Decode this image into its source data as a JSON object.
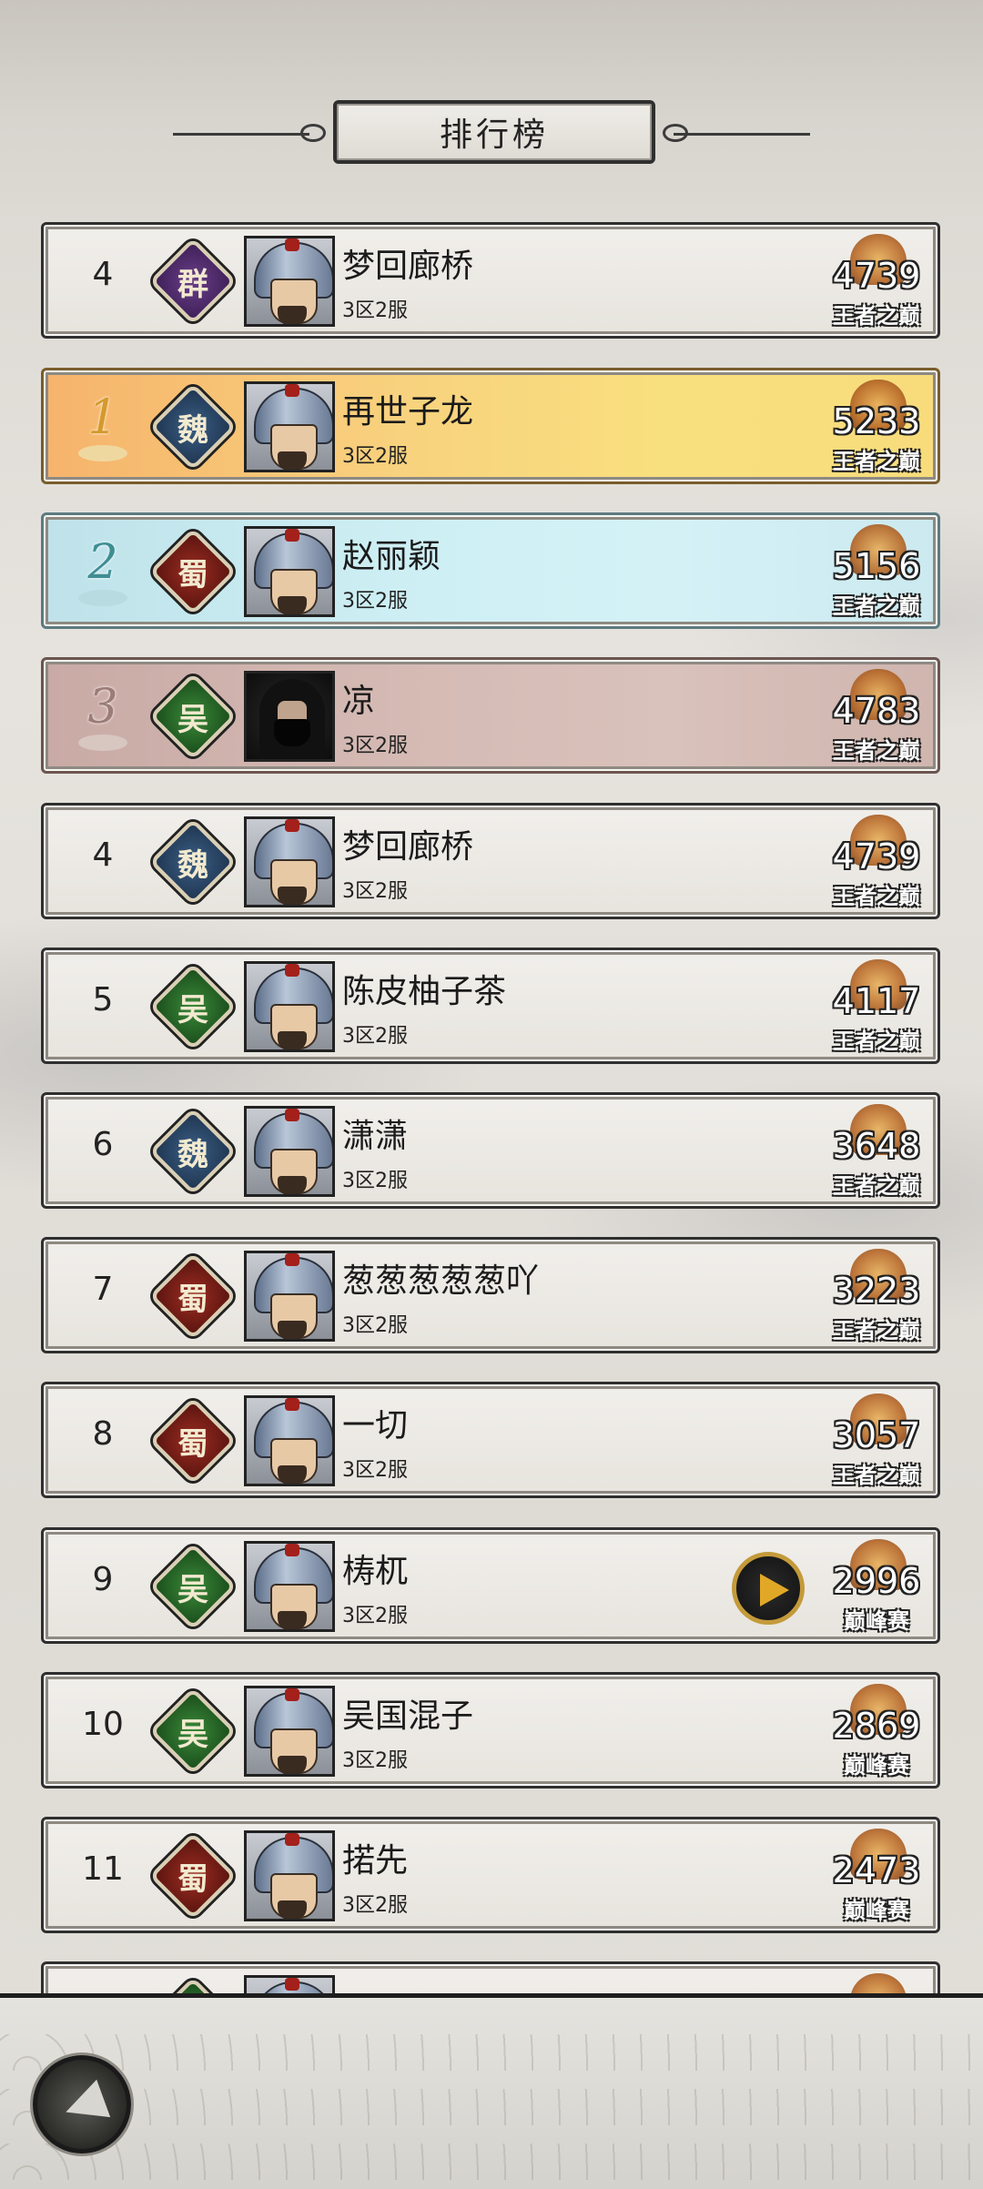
{
  "header": {
    "title": "排行榜"
  },
  "my_entry": {
    "rank": "4",
    "faction": "群",
    "name": "梦回廊桥",
    "server": "3区2服",
    "score": "4739",
    "tier": "王者之巅"
  },
  "entries": [
    {
      "rank": "1",
      "faction": "魏",
      "name": "再世子龙",
      "server": "3区2服",
      "score": "5233",
      "tier": "王者之巅"
    },
    {
      "rank": "2",
      "faction": "蜀",
      "name": "赵丽颖",
      "server": "3区2服",
      "score": "5156",
      "tier": "王者之巅"
    },
    {
      "rank": "3",
      "faction": "吴",
      "name": "凉",
      "server": "3区2服",
      "score": "4783",
      "tier": "王者之巅"
    },
    {
      "rank": "4",
      "faction": "魏",
      "name": "梦回廊桥",
      "server": "3区2服",
      "score": "4739",
      "tier": "王者之巅"
    },
    {
      "rank": "5",
      "faction": "吴",
      "name": "陈皮柚子茶",
      "server": "3区2服",
      "score": "4117",
      "tier": "王者之巅"
    },
    {
      "rank": "6",
      "faction": "魏",
      "name": "潇潇",
      "server": "3区2服",
      "score": "3648",
      "tier": "王者之巅"
    },
    {
      "rank": "7",
      "faction": "蜀",
      "name": "葱葱葱葱葱吖",
      "server": "3区2服",
      "score": "3223",
      "tier": "王者之巅"
    },
    {
      "rank": "8",
      "faction": "蜀",
      "name": "一切",
      "server": "3区2服",
      "score": "3057",
      "tier": "王者之巅"
    },
    {
      "rank": "9",
      "faction": "吴",
      "name": "梼杌",
      "server": "3区2服",
      "score": "2996",
      "tier": "巅峰赛"
    },
    {
      "rank": "10",
      "faction": "吴",
      "name": "吴国混子",
      "server": "3区2服",
      "score": "2869",
      "tier": "巅峰赛"
    },
    {
      "rank": "11",
      "faction": "蜀",
      "name": "掿先",
      "server": "3区2服",
      "score": "2473",
      "tier": "巅峰赛"
    },
    {
      "rank": "",
      "faction": "吴",
      "name": "",
      "server": "",
      "score": "",
      "tier": ""
    }
  ]
}
